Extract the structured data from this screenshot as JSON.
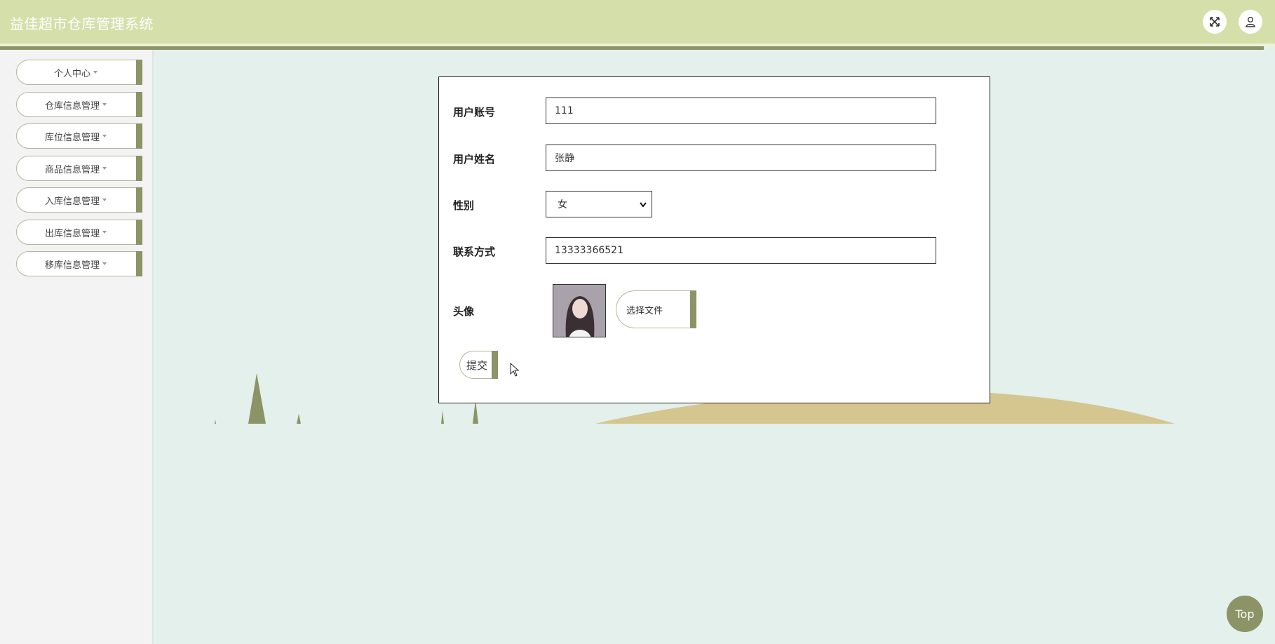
{
  "header": {
    "title": "益佳超市仓库管理系统",
    "fullscreen_icon": "fullscreen-icon",
    "user_icon": "user-icon"
  },
  "sidebar": {
    "items": [
      {
        "label": "个人中心"
      },
      {
        "label": "仓库信息管理"
      },
      {
        "label": "库位信息管理"
      },
      {
        "label": "商品信息管理"
      },
      {
        "label": "入库信息管理"
      },
      {
        "label": "出库信息管理"
      },
      {
        "label": "移库信息管理"
      }
    ]
  },
  "form": {
    "account": {
      "label": "用户账号",
      "value": "111"
    },
    "name": {
      "label": "用户姓名",
      "value": "张静"
    },
    "gender": {
      "label": "性别",
      "value": "女"
    },
    "phone": {
      "label": "联系方式",
      "value": "13333366521"
    },
    "avatar": {
      "label": "头像",
      "file_button": "选择文件"
    },
    "submit_label": "提交"
  },
  "top_button": "Top",
  "colors": {
    "header_bg": "#d5dfa9",
    "accent": "#8b9367",
    "main_bg": "#e3f0eb",
    "sidebar_bg": "#f2f3f2"
  }
}
